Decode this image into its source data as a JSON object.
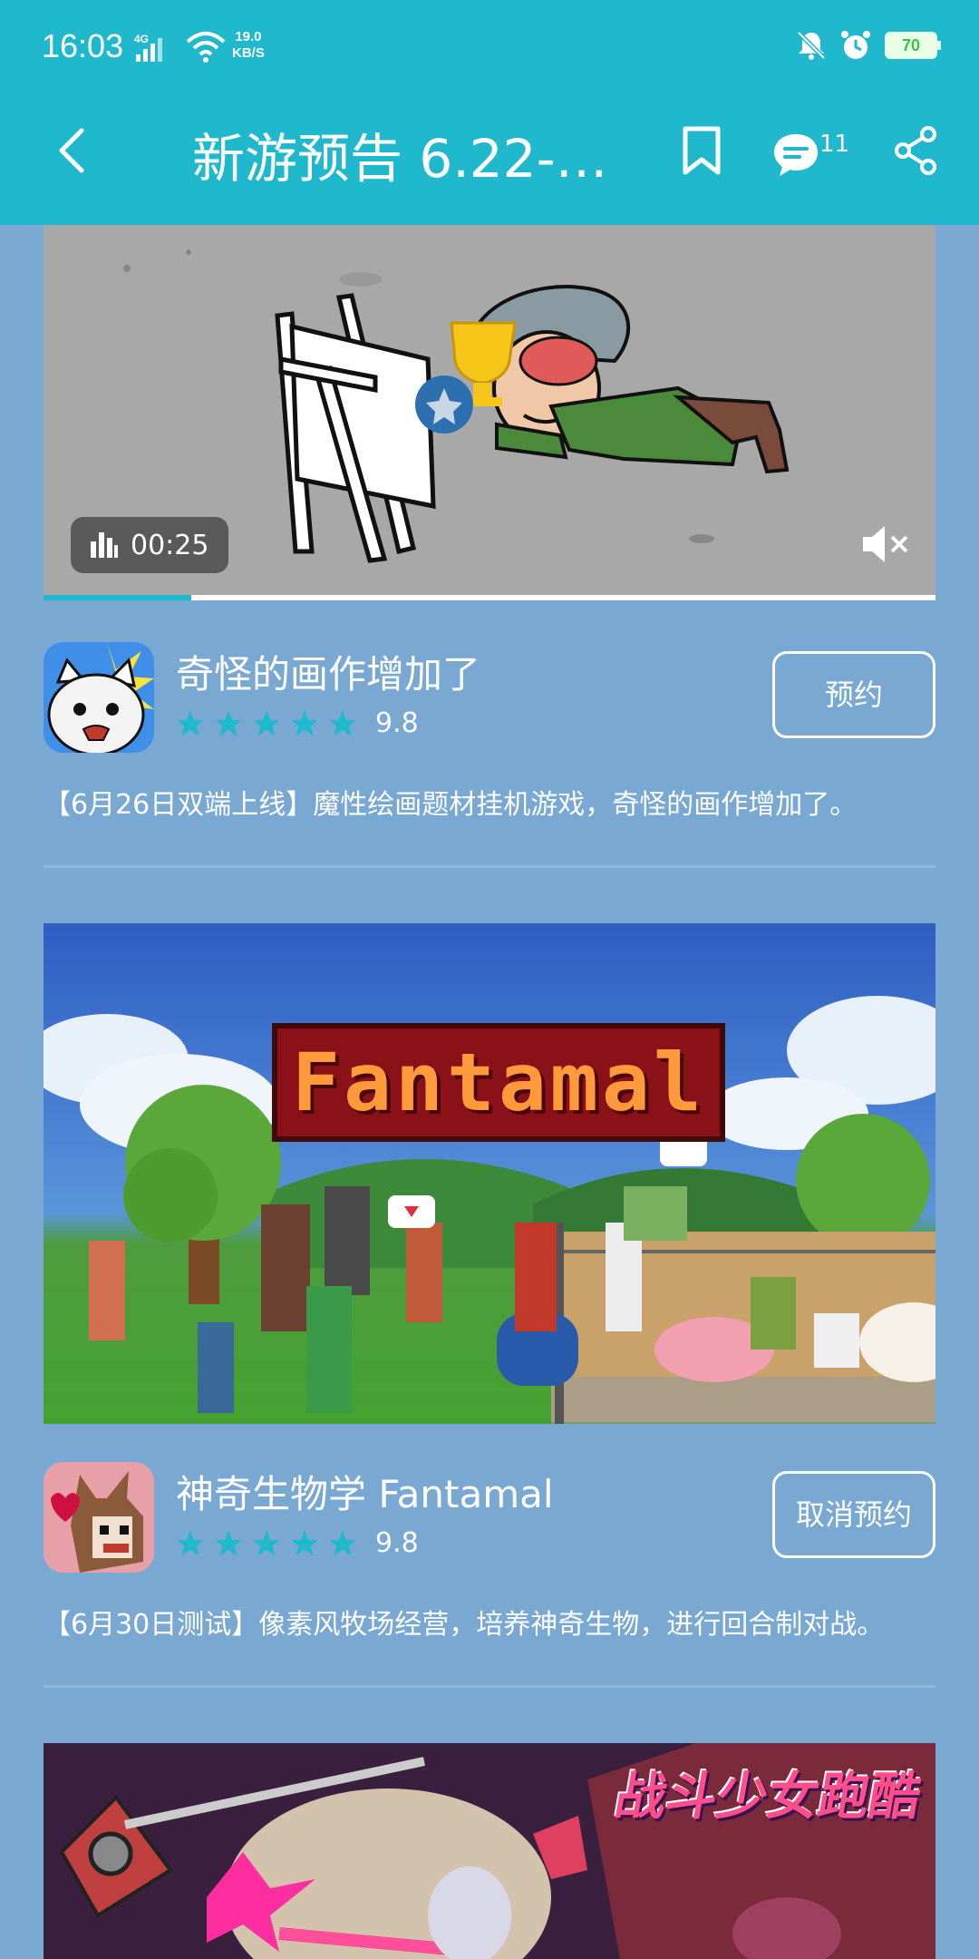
{
  "status_bar": {
    "time": "16:03",
    "network": "4G",
    "speed_value": "19.0",
    "speed_unit": "KB/S",
    "battery": "70"
  },
  "header": {
    "title": "新游预告 6.22-6...",
    "comment_count": "11",
    "icons": [
      "back-icon",
      "bookmark-icon",
      "comment-icon",
      "share-icon"
    ]
  },
  "video": {
    "duration": "00:25",
    "progress": 0.166
  },
  "games": [
    {
      "name": "奇怪的画作增加了",
      "rating": "9.8",
      "button": "预约",
      "description": "【6月26日双端上线】魔性绘画题材挂机游戏，奇怪的画作增加了。"
    },
    {
      "name": "神奇生物学 Fantamal",
      "rating": "9.8",
      "button": "取消预约",
      "description": "【6月30日测试】像素风牧场经营，培养神奇生物，进行回合制对战。",
      "banner_title": "Fantamal"
    },
    {
      "banner_logo": "战斗少女跑酷"
    }
  ],
  "colors": {
    "header_bg": "#1fb8cd",
    "page_bg": "#79a9d2",
    "star": "#1fb8cd"
  }
}
